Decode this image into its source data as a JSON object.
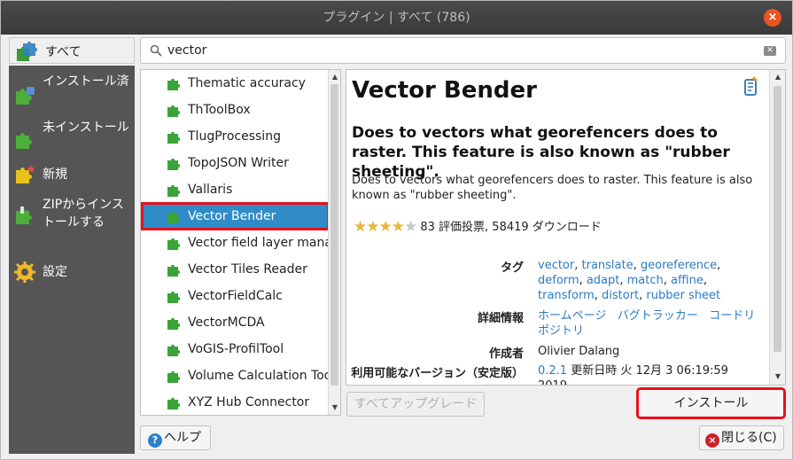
{
  "window": {
    "title": "プラグイン | すべて (786)"
  },
  "sidebar": {
    "all_label": "すべて",
    "items": [
      {
        "label": "インストール済",
        "icon": "installed-puzzle-icon"
      },
      {
        "label": "未インストール",
        "icon": "not-installed-puzzle-icon"
      },
      {
        "label": "新規",
        "icon": "new-puzzle-icon"
      },
      {
        "label": "ZIPからインストールする",
        "icon": "zip-install-icon"
      },
      {
        "label": "設定",
        "icon": "settings-gear-icon"
      }
    ]
  },
  "search": {
    "value": "vector"
  },
  "plugin_list": [
    "Thematic accuracy",
    "ThToolBox",
    "TlugProcessing",
    "TopoJSON Writer",
    "Vallaris",
    "Vector Bender",
    "Vector field layer mana",
    "Vector Tiles Reader",
    "VectorFieldCalc",
    "VectorMCDA",
    "VoGIS-ProfilTool",
    "Volume Calculation Too",
    "XYZ Hub Connector"
  ],
  "selected_plugin": "Vector Bender",
  "detail": {
    "name": "Vector Bender",
    "summary": "Does to vectors what georefencers does to raster. This feature is also known as \"rubber sheeting\".",
    "description": "Does to vectors what georefencers does to raster. This feature is also known as \"rubber sheeting\".",
    "rating_stars": 4,
    "rating_text": "83 評価投票, 58419 ダウンロード",
    "tags_label": "タグ",
    "tags": [
      "vector",
      "translate",
      "georeference",
      "deform",
      "adapt",
      "match",
      "affine",
      "transform",
      "distort",
      "rubber sheet"
    ],
    "more_info_label": "詳細情報",
    "homepage": "ホームページ",
    "bug_tracker": "バグトラッカー",
    "repository": "コードリポジトリ",
    "author_label": "作成者",
    "author": "Olivier Dalang",
    "available_version_label": "利用可能なバージョン（安定版）",
    "version": "0.2.1",
    "updated": "更新日時 火 12月 3 06:19:59",
    "updated_year": "2019"
  },
  "buttons": {
    "upgrade_all": "すべてアップグレード",
    "install": "インストール",
    "help": "ヘルプ",
    "close": "閉じる(C)"
  },
  "colors": {
    "selection": "#308cc6",
    "highlight_outline": "#e8101e",
    "sidebar_bg": "#555556",
    "link": "#2a7bc2",
    "title_close": "#e95420"
  }
}
